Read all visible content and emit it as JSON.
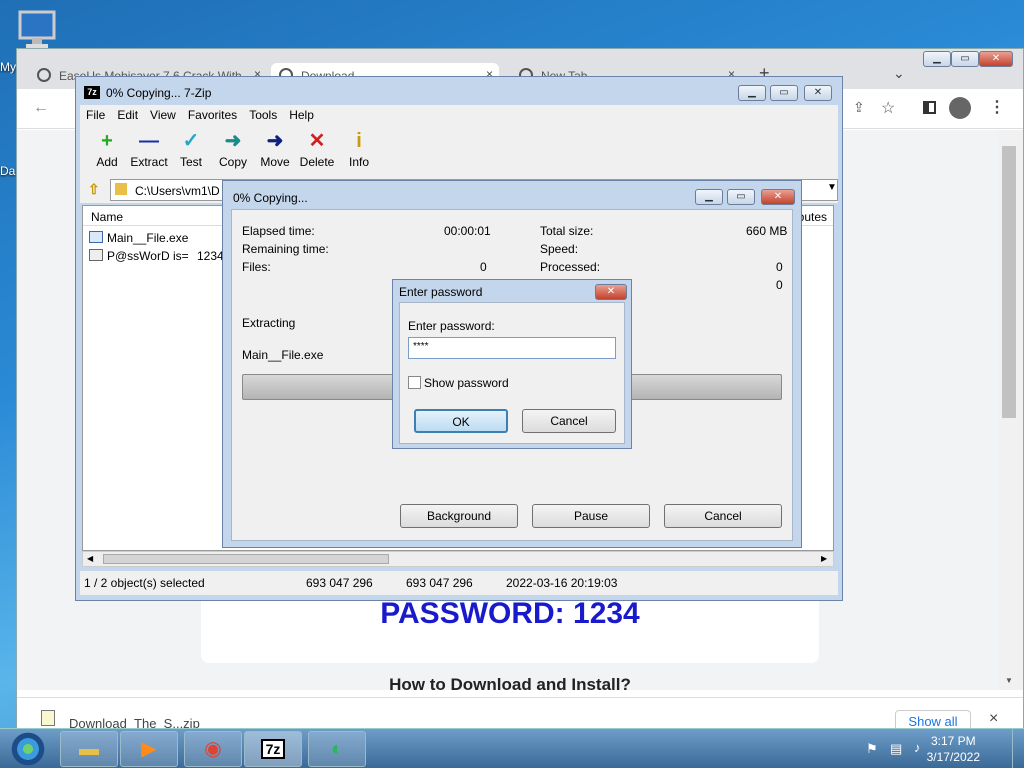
{
  "desktop": {
    "icons": [
      {
        "label": "My"
      },
      {
        "label": "Da"
      }
    ]
  },
  "chrome": {
    "tabs": [
      {
        "label": "EaseUs Mobisaver 7.6 Crack With",
        "close": "×"
      },
      {
        "label": "Download",
        "close": "×"
      },
      {
        "label": "New Tab",
        "close": "×"
      }
    ],
    "new_tab": "+",
    "tab_menu": "⌄",
    "page": {
      "password_banner": "PASSWORD: 1234",
      "how_to": "How to Download and Install?"
    },
    "download_bar": {
      "item": "Download_The_S...zip",
      "show_all": "Show all",
      "close": "×"
    }
  },
  "zip": {
    "title": "0% Copying... 7-Zip",
    "logo": "7z",
    "menu": [
      "File",
      "Edit",
      "View",
      "Favorites",
      "Tools",
      "Help"
    ],
    "toolbar": [
      {
        "label": "Add",
        "icon": "+",
        "color": "#22aa22"
      },
      {
        "label": "Extract",
        "icon": "—",
        "color": "#1a2ea8"
      },
      {
        "label": "Test",
        "icon": "✓",
        "color": "#22a8c8"
      },
      {
        "label": "Copy",
        "icon": "➜",
        "color": "#1a8a8a"
      },
      {
        "label": "Move",
        "icon": "➜",
        "color": "#102080"
      },
      {
        "label": "Delete",
        "icon": "✕",
        "color": "#d02020"
      },
      {
        "label": "Info",
        "icon": "i",
        "color": "#c89a10"
      }
    ],
    "address": "C:\\Users\\vm1\\D",
    "columns": {
      "name": "Name",
      "attributes": "ributes"
    },
    "files": [
      {
        "name": "Main__File.exe"
      },
      {
        "name": "P@ssWorD is=",
        "extra": "1234."
      }
    ],
    "status": {
      "selected": "1 / 2 object(s) selected",
      "size1": "693 047 296",
      "size2": "693 047 296",
      "modified": "2022-03-16 20:19:03"
    }
  },
  "copying": {
    "title": "0% Copying...",
    "elapsed_label": "Elapsed time:",
    "elapsed_value": "00:00:01",
    "remaining_label": "Remaining time:",
    "files_label": "Files:",
    "files_value": "0",
    "total_size_label": "Total size:",
    "total_size_value": "660 MB",
    "speed_label": "Speed:",
    "processed_label": "Processed:",
    "processed_value": "0",
    "compressed_value": "0",
    "action": "Extracting",
    "current_file": "Main__File.exe",
    "progress": 0,
    "buttons": {
      "background": "Background",
      "pause": "Pause",
      "cancel": "Cancel"
    }
  },
  "password_dialog": {
    "title": "Enter password",
    "prompt": "Enter password:",
    "value": "****",
    "show_password": "Show password",
    "show_password_checked": false,
    "ok": "OK",
    "cancel": "Cancel"
  },
  "taskbar": {
    "apps": [
      "explorer",
      "media-player",
      "chrome",
      "7zip",
      "app"
    ],
    "zip_label": "7z",
    "time": "3:17 PM",
    "date": "3/17/2022"
  }
}
